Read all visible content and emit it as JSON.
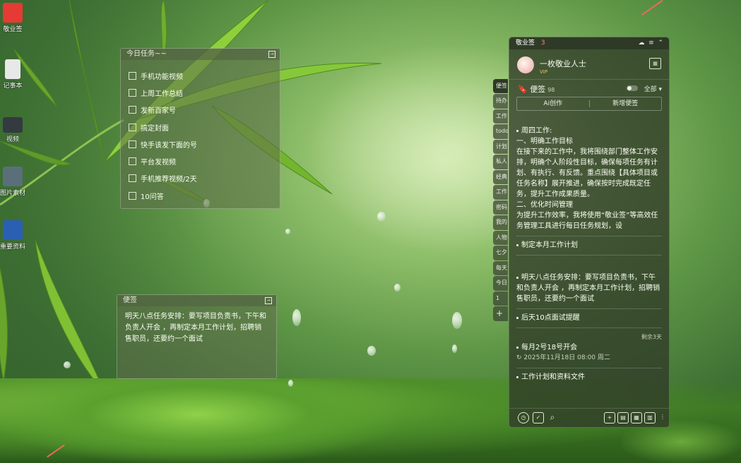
{
  "desktop_icons": [
    {
      "label": "敬业签",
      "icon": "cloud-app-icon",
      "color": "#e63a34"
    },
    {
      "label": "记事本",
      "icon": "notepad-icon",
      "color": "#d9d9d9"
    },
    {
      "label": "视频",
      "icon": "video-file-icon",
      "color": "#333a40"
    },
    {
      "label": "图片素材",
      "icon": "image-folder-icon",
      "color": "#5a6f7a"
    },
    {
      "label": "重要资料",
      "icon": "word-document-icon",
      "color": "#2b5fb3"
    }
  ],
  "today_widget": {
    "title": "今日任务~~",
    "items": [
      "手机功能视频",
      "上周工作总结",
      "发新百家号",
      "搞定封面",
      "快手该发下面的号",
      "平台发视频",
      "手机推荐视频/2天",
      "10问答"
    ]
  },
  "note_widget": {
    "title": "便签",
    "text": "明天八点任务安排：要写项目负责书，下午和负责人开会 ，再制定本月工作计划，招聘销售职员，还要约一个面试"
  },
  "panel": {
    "app_name": "敬业签",
    "count": "3",
    "username": "一枚敬业人士",
    "vip": "VIP",
    "notes_label": "便签",
    "notes_count": "98",
    "filter": "全部",
    "ai_button": "Ai创作",
    "new_button": "新增便签",
    "notes": [
      {
        "title": "周四工作:",
        "body": "一、明确工作目标\n在接下来的工作中，我将围绕部门整体工作安排，明确个人阶段性目标，确保每项任务有计划、有执行、有反馈。重点围绕【具体项目或任务名称】展开推进，确保按时完成既定任务，提升工作成果质量。\n二、优化时间管理\n为提升工作效率，我将使用“敬业签”等高效任务管理工具进行每日任务规划，设"
      },
      {
        "title": "制定本月工作计划",
        "body": ""
      },
      {
        "title": "明天八点任务安排：要写项目负责书，下午和负责人开会 ，再制定本月工作计划，招聘销售职员，还要约一个面试",
        "body": ""
      },
      {
        "title": "后天10点面试提醒",
        "body": ""
      },
      {
        "title": "每月2号18号开会",
        "remain": "剩余3天",
        "reminder": "2025年11月18日 08:00 周二"
      },
      {
        "title": "工作计划和资料文件",
        "body": ""
      }
    ]
  },
  "side_tabs": [
    "便签",
    "待办",
    "工作",
    "todo",
    "计划",
    "私人",
    "经典",
    "工作",
    "密码",
    "我的",
    "人物",
    "七夕",
    "每天",
    "今日",
    "1",
    "+"
  ]
}
